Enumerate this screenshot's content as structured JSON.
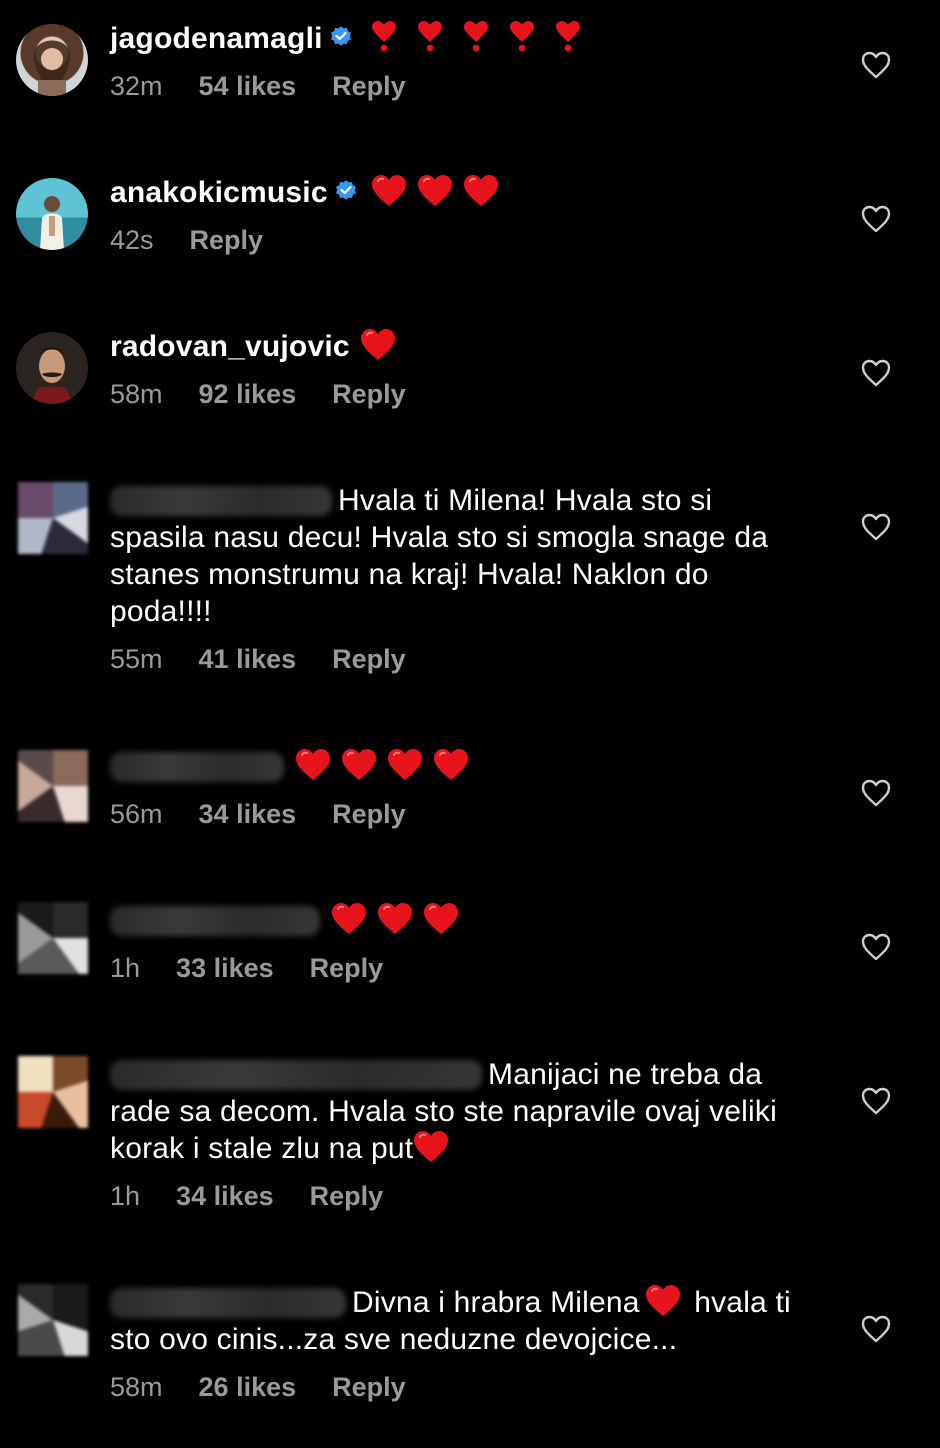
{
  "comments": [
    {
      "username": "jagodenamagli",
      "verified": true,
      "hearts": 5,
      "heart_style": "exclamation",
      "text": "",
      "time": "32m",
      "likes": "54 likes",
      "reply": "Reply"
    },
    {
      "username": "anakokicmusic",
      "verified": true,
      "hearts": 3,
      "text": "",
      "time": "42s",
      "likes": "",
      "reply": "Reply"
    },
    {
      "username": "radovan_vujovic",
      "verified": false,
      "hearts": 1,
      "text": "",
      "time": "58m",
      "likes": "92 likes",
      "reply": "Reply"
    },
    {
      "username": "",
      "verified": false,
      "hearts": 0,
      "text": "Hvala ti Milena! Hvala sto si spasila nasu decu! Hvala sto si smogla snage da stanes monstrumu na kraj! Hvala! Naklon do poda!!!!",
      "time": "55m",
      "likes": "41 likes",
      "reply": "Reply"
    },
    {
      "username": "",
      "verified": false,
      "hearts": 4,
      "text": "",
      "time": "56m",
      "likes": "34 likes",
      "reply": "Reply"
    },
    {
      "username": "",
      "verified": false,
      "hearts": 3,
      "text": "",
      "time": "1h",
      "likes": "33 likes",
      "reply": "Reply"
    },
    {
      "username": "",
      "verified": false,
      "hearts": 0,
      "text": "Manijaci ne treba da rade sa decom. Hvala sto ste napravile ovaj veliki korak i stale zlu na put",
      "time": "1h",
      "likes": "34 likes",
      "reply": "Reply"
    },
    {
      "username": "",
      "verified": false,
      "hearts": 0,
      "text_a": "Divna i hrabra Milena",
      "text_b": "hvala ti sto ovo cinis...za sve  neduzne devojcice...",
      "time": "58m",
      "likes": "26 likes",
      "reply": "Reply"
    }
  ],
  "icons": {
    "verified": "verified-badge-icon",
    "heart": "red-heart-emoji",
    "like": "heart-outline-icon"
  },
  "colors": {
    "background": "#000000",
    "text": "#ffffff",
    "meta": "#9a9a9a",
    "verified": "#3897f0",
    "heart": "#e8141c"
  }
}
